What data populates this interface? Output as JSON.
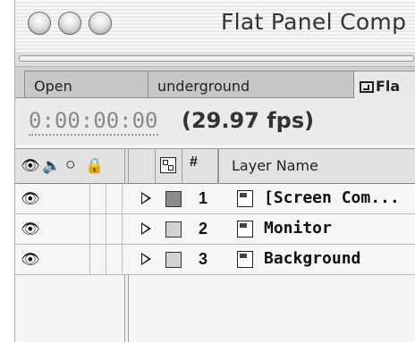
{
  "window": {
    "title": "Flat Panel Comp"
  },
  "tabs": [
    {
      "label": "Open"
    },
    {
      "label": "underground"
    },
    {
      "label": "Fla",
      "active": true
    }
  ],
  "time": {
    "timecode": "0:00:00:00",
    "fps": "(29.97 fps)"
  },
  "header": {
    "switch_icons": [
      "eye-icon",
      "speaker-icon",
      "solo-icon",
      "lock-icon"
    ],
    "shy_icon": "shy-icon",
    "number_label": "#",
    "layer_name_label": "Layer Name"
  },
  "layers": [
    {
      "number": "1",
      "name": "[Screen Com...",
      "label_color": "#8c8c8c",
      "icon": "comp-icon"
    },
    {
      "number": "2",
      "name": "Monitor",
      "label_color": "#d2d2d2",
      "icon": "footage-icon"
    },
    {
      "number": "3",
      "name": "Background",
      "label_color": "#d2d2d2",
      "icon": "footage-icon"
    }
  ]
}
